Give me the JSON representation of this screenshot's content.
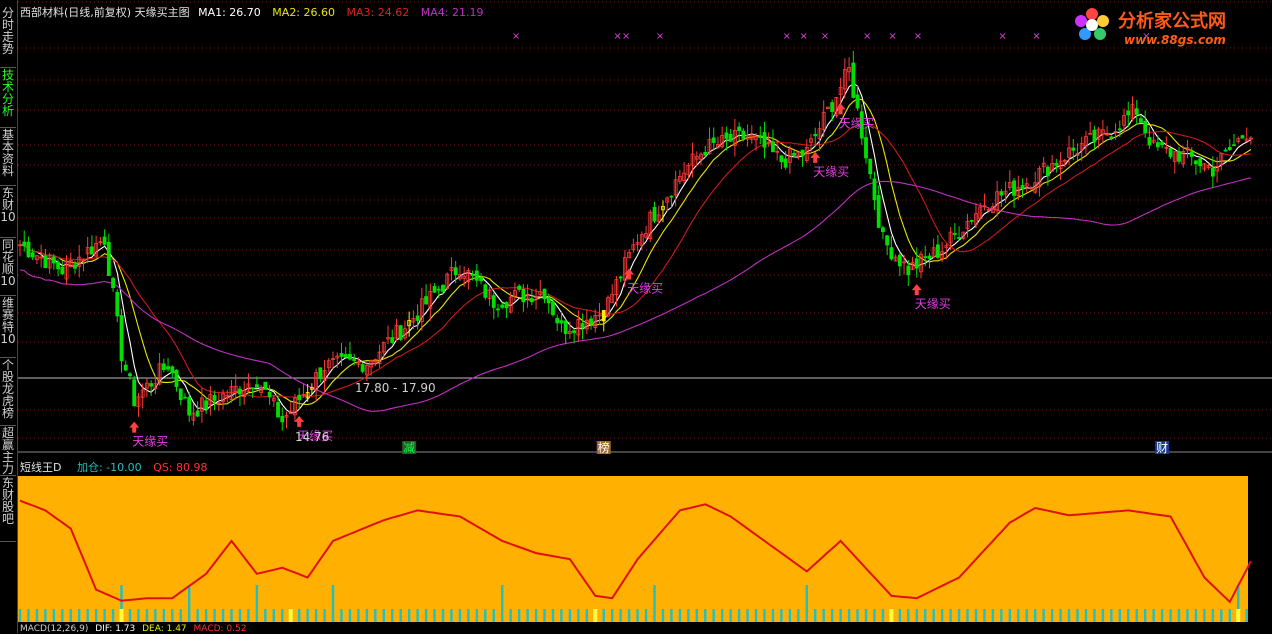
{
  "sidebar": {
    "tabs": [
      {
        "label": "分时走势",
        "color": "#d0d0d0"
      },
      {
        "label": "技术分析",
        "color": "#22ff22"
      },
      {
        "label": "基本资料",
        "color": "#d0d0d0"
      },
      {
        "label": "东财10",
        "color": "#d0d0d0"
      },
      {
        "label": "同花顺10",
        "color": "#d0d0d0"
      },
      {
        "label": "维赛特10",
        "color": "#d0d0d0"
      },
      {
        "label": "个股龙虎榜",
        "color": "#d0d0d0"
      },
      {
        "label": "超赢主力",
        "color": "#d0d0d0"
      },
      {
        "label": "东财股吧",
        "color": "#d0d0d0"
      }
    ]
  },
  "header": {
    "title": "西部材料(日线,前复权) 天缘买主图",
    "ma1": "MA1: 26.70",
    "ma2": "MA2: 26.60",
    "ma3": "MA3: 24.62",
    "ma4": "MA4: 21.19"
  },
  "logo": {
    "name": "分析家公式网",
    "url": "www.88gs.com"
  },
  "price_range_label": "17.80 - 17.90",
  "low_label": "14.76",
  "markers": [
    {
      "label": "天缘买",
      "bar": 27
    },
    {
      "label": "天缘买",
      "bar": 66
    },
    {
      "label": "天缘买",
      "bar": 144
    },
    {
      "label": "天缘买",
      "bar": 188
    },
    {
      "label": "天缘买",
      "bar": 194
    },
    {
      "label": "天缘买",
      "bar": 212
    }
  ],
  "events": [
    {
      "label": "减",
      "bar": 92,
      "bg": "#2a5a2a",
      "color": "#00ff40"
    },
    {
      "label": "榜",
      "bar": 138,
      "bg": "#a06a20",
      "color": "#ffffff"
    },
    {
      "label": "财",
      "bar": 270,
      "bg": "#1a3a8a",
      "color": "#ffffff"
    }
  ],
  "indicator": {
    "name": "短线王D",
    "jiacang": "加仓: -10.00",
    "qs": "QS: 80.98"
  },
  "bottom": {
    "macd": "MACD(12,26,9)",
    "dif": "DIF: 1.73",
    "dea": "DEA: 1.47",
    "macd_val": "MACD: 0.52"
  },
  "colors": {
    "up": "#ff3a3a",
    "down": "#00e000",
    "ma1": "#ffffff",
    "ma2": "#e8e800",
    "ma3": "#cc1a1a",
    "ma4": "#c030c0",
    "osc_bg": "#ffb000",
    "osc_line": "#e01010",
    "osc_tick": "#20c0c0"
  },
  "chart_data": {
    "type": "candlestick",
    "title": "西部材料(日线,前复权) 天缘买主图",
    "series": [
      {
        "name": "MA1",
        "value": 26.7
      },
      {
        "name": "MA2",
        "value": 26.6
      },
      {
        "name": "MA3",
        "value": 24.62
      },
      {
        "name": "MA4",
        "value": 21.19
      }
    ],
    "annotations": [
      "17.80 - 17.90",
      "14.76"
    ],
    "oscillator": {
      "name": "短线王D",
      "加仓": -10.0,
      "QS": 80.98
    },
    "keypoints": [
      [
        0,
        23.2
      ],
      [
        10,
        22.0
      ],
      [
        20,
        23.5
      ],
      [
        24,
        18.0
      ],
      [
        27,
        15.8
      ],
      [
        35,
        17.5
      ],
      [
        40,
        15.2
      ],
      [
        48,
        16.0
      ],
      [
        56,
        16.8
      ],
      [
        62,
        14.8
      ],
      [
        72,
        17.4
      ],
      [
        82,
        17.6
      ],
      [
        92,
        19.5
      ],
      [
        104,
        22.2
      ],
      [
        112,
        20.5
      ],
      [
        124,
        21.0
      ],
      [
        128,
        19.2
      ],
      [
        138,
        20.0
      ],
      [
        146,
        23.5
      ],
      [
        156,
        26.5
      ],
      [
        162,
        27.8
      ],
      [
        172,
        28.4
      ],
      [
        180,
        27.2
      ],
      [
        186,
        27.6
      ],
      [
        196,
        31.5
      ],
      [
        200,
        27.6
      ],
      [
        204,
        23.4
      ],
      [
        210,
        22.0
      ],
      [
        218,
        23.0
      ],
      [
        228,
        25.2
      ],
      [
        238,
        26.2
      ],
      [
        248,
        27.6
      ],
      [
        256,
        28.4
      ],
      [
        264,
        29.6
      ],
      [
        268,
        27.8
      ],
      [
        276,
        27.4
      ],
      [
        282,
        26.8
      ],
      [
        290,
        28.6
      ]
    ],
    "oscillator_keypoints": [
      [
        0,
        88
      ],
      [
        6,
        80
      ],
      [
        12,
        65
      ],
      [
        18,
        15
      ],
      [
        24,
        6
      ],
      [
        30,
        8
      ],
      [
        36,
        8
      ],
      [
        44,
        28
      ],
      [
        50,
        55
      ],
      [
        56,
        28
      ],
      [
        62,
        33
      ],
      [
        68,
        25
      ],
      [
        74,
        55
      ],
      [
        86,
        72
      ],
      [
        94,
        80
      ],
      [
        104,
        75
      ],
      [
        114,
        55
      ],
      [
        122,
        45
      ],
      [
        130,
        40
      ],
      [
        136,
        10
      ],
      [
        140,
        8
      ],
      [
        146,
        40
      ],
      [
        156,
        80
      ],
      [
        162,
        85
      ],
      [
        168,
        75
      ],
      [
        176,
        55
      ],
      [
        186,
        30
      ],
      [
        194,
        55
      ],
      [
        202,
        25
      ],
      [
        206,
        10
      ],
      [
        212,
        8
      ],
      [
        222,
        25
      ],
      [
        234,
        70
      ],
      [
        240,
        82
      ],
      [
        248,
        76
      ],
      [
        262,
        80
      ],
      [
        272,
        75
      ],
      [
        280,
        25
      ],
      [
        286,
        5
      ],
      [
        292,
        45
      ]
    ],
    "xlabel": "",
    "ylabel": ""
  }
}
